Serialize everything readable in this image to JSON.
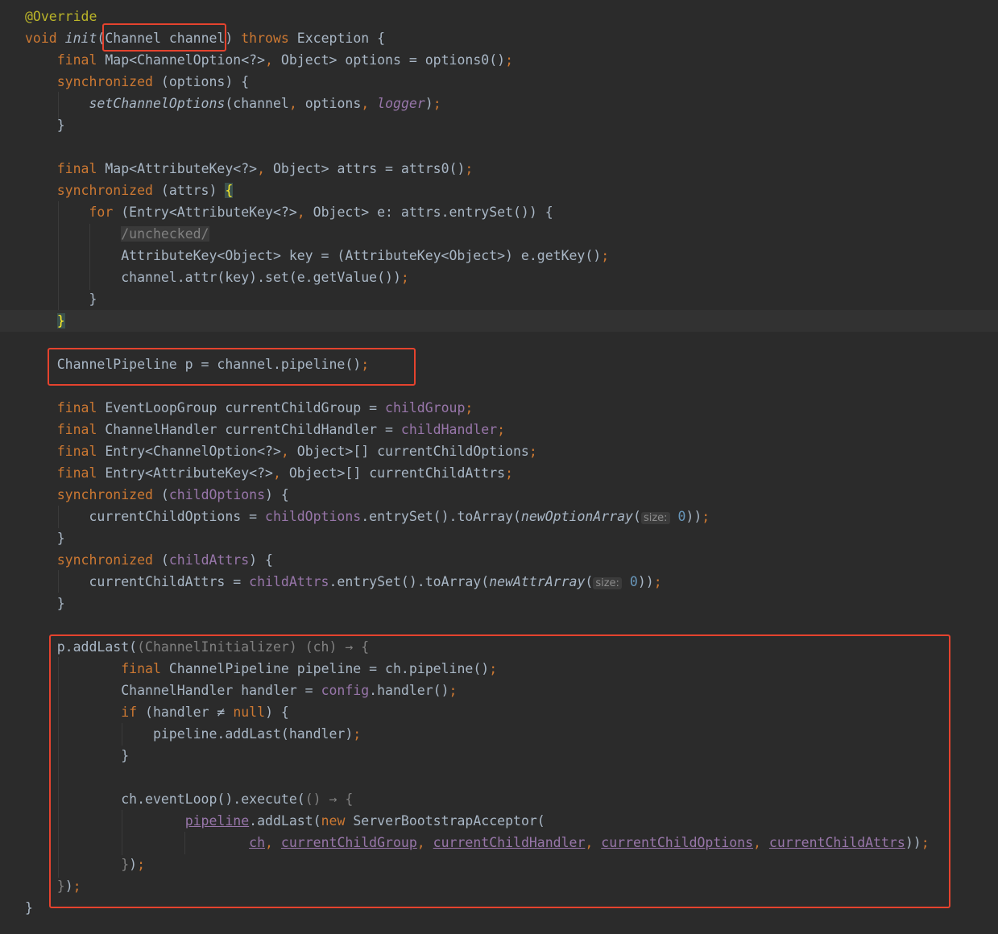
{
  "code": {
    "lines": [
      [
        {
          "t": "@Override",
          "c": "ann"
        }
      ],
      [
        {
          "t": "void ",
          "c": "kw"
        },
        {
          "t": "init",
          "c": "it"
        },
        {
          "t": "("
        },
        {
          "t": "Channel channel"
        },
        {
          "t": ") "
        },
        {
          "t": "throws ",
          "c": "kw"
        },
        {
          "t": "Exception {"
        }
      ],
      [
        {
          "t": "    "
        },
        {
          "t": "final ",
          "c": "kw"
        },
        {
          "t": "Map<ChannelOption<?>"
        },
        {
          "t": ", ",
          "c": "kw"
        },
        {
          "t": "Object> options = options0()"
        },
        {
          "t": ";",
          "c": "kw"
        }
      ],
      [
        {
          "t": "    "
        },
        {
          "t": "synchronized ",
          "c": "kw"
        },
        {
          "t": "(options) {"
        }
      ],
      [
        {
          "t": "        "
        },
        {
          "t": "setChannelOptions",
          "c": "it"
        },
        {
          "t": "(channel"
        },
        {
          "t": ", ",
          "c": "kw"
        },
        {
          "t": "options"
        },
        {
          "t": ", ",
          "c": "kw"
        },
        {
          "t": "logger",
          "c": "field it"
        },
        {
          "t": ")"
        },
        {
          "t": ";",
          "c": "kw"
        }
      ],
      [
        {
          "t": "    }"
        }
      ],
      [],
      [
        {
          "t": "    "
        },
        {
          "t": "final ",
          "c": "kw"
        },
        {
          "t": "Map<AttributeKey<?>"
        },
        {
          "t": ", ",
          "c": "kw"
        },
        {
          "t": "Object> attrs = attrs0()"
        },
        {
          "t": ";",
          "c": "kw"
        }
      ],
      [
        {
          "t": "    "
        },
        {
          "t": "synchronized ",
          "c": "kw"
        },
        {
          "t": "(attrs) "
        },
        {
          "t": "{",
          "c": "brace-match"
        }
      ],
      [
        {
          "t": "        "
        },
        {
          "t": "for ",
          "c": "kw"
        },
        {
          "t": "(Entry<AttributeKey<?>"
        },
        {
          "t": ", ",
          "c": "kw"
        },
        {
          "t": "Object> e: attrs.entrySet()) {"
        }
      ],
      [
        {
          "t": "            "
        },
        {
          "t": "/unchecked/",
          "c": "cmt"
        }
      ],
      [
        {
          "t": "            AttributeKey<Object> key = (AttributeKey<Object>) e.getKey()"
        },
        {
          "t": ";",
          "c": "kw"
        }
      ],
      [
        {
          "t": "            channel.attr(key).set(e.getValue())"
        },
        {
          "t": ";",
          "c": "kw"
        }
      ],
      [
        {
          "t": "        }"
        }
      ],
      [
        {
          "t": "    "
        },
        {
          "t": "}",
          "c": "brace-match"
        }
      ],
      [],
      [
        {
          "t": "    ChannelPipeline p = channel.pipeline()"
        },
        {
          "t": ";",
          "c": "kw"
        }
      ],
      [],
      [
        {
          "t": "    "
        },
        {
          "t": "final ",
          "c": "kw"
        },
        {
          "t": "EventLoopGroup currentChildGroup = "
        },
        {
          "t": "childGroup",
          "c": "field"
        },
        {
          "t": ";",
          "c": "kw"
        }
      ],
      [
        {
          "t": "    "
        },
        {
          "t": "final ",
          "c": "kw"
        },
        {
          "t": "ChannelHandler currentChildHandler = "
        },
        {
          "t": "childHandler",
          "c": "field"
        },
        {
          "t": ";",
          "c": "kw"
        }
      ],
      [
        {
          "t": "    "
        },
        {
          "t": "final ",
          "c": "kw"
        },
        {
          "t": "Entry<ChannelOption<?>"
        },
        {
          "t": ", ",
          "c": "kw"
        },
        {
          "t": "Object>[] currentChildOptions"
        },
        {
          "t": ";",
          "c": "kw"
        }
      ],
      [
        {
          "t": "    "
        },
        {
          "t": "final ",
          "c": "kw"
        },
        {
          "t": "Entry<AttributeKey<?>"
        },
        {
          "t": ", ",
          "c": "kw"
        },
        {
          "t": "Object>[] currentChildAttrs"
        },
        {
          "t": ";",
          "c": "kw"
        }
      ],
      [
        {
          "t": "    "
        },
        {
          "t": "synchronized ",
          "c": "kw"
        },
        {
          "t": "("
        },
        {
          "t": "childOptions",
          "c": "field"
        },
        {
          "t": ") {"
        }
      ],
      [
        {
          "t": "        currentChildOptions = "
        },
        {
          "t": "childOptions",
          "c": "field"
        },
        {
          "t": ".entrySet().toArray("
        },
        {
          "t": "newOptionArray",
          "c": "it"
        },
        {
          "t": "("
        },
        {
          "t": "size:",
          "c": "hint"
        },
        {
          "t": " "
        },
        {
          "t": "0",
          "c": "num"
        },
        {
          "t": "))"
        },
        {
          "t": ";",
          "c": "kw"
        }
      ],
      [
        {
          "t": "    }"
        }
      ],
      [
        {
          "t": "    "
        },
        {
          "t": "synchronized ",
          "c": "kw"
        },
        {
          "t": "("
        },
        {
          "t": "childAttrs",
          "c": "field"
        },
        {
          "t": ") {"
        }
      ],
      [
        {
          "t": "        currentChildAttrs = "
        },
        {
          "t": "childAttrs",
          "c": "field"
        },
        {
          "t": ".entrySet().toArray("
        },
        {
          "t": "newAttrArray",
          "c": "it"
        },
        {
          "t": "("
        },
        {
          "t": "size:",
          "c": "hint"
        },
        {
          "t": " "
        },
        {
          "t": "0",
          "c": "num"
        },
        {
          "t": "))"
        },
        {
          "t": ";",
          "c": "kw"
        }
      ],
      [
        {
          "t": "    }"
        }
      ],
      [],
      [
        {
          "t": "    p.addLast("
        },
        {
          "t": "(ChannelInitializer) (ch) → {",
          "c": "gray"
        }
      ],
      [
        {
          "t": "            "
        },
        {
          "t": "final ",
          "c": "kw"
        },
        {
          "t": "ChannelPipeline pipeline = ch.pipeline()"
        },
        {
          "t": ";",
          "c": "kw"
        }
      ],
      [
        {
          "t": "            ChannelHandler handler = "
        },
        {
          "t": "config",
          "c": "field"
        },
        {
          "t": ".handler()"
        },
        {
          "t": ";",
          "c": "kw"
        }
      ],
      [
        {
          "t": "            "
        },
        {
          "t": "if ",
          "c": "kw"
        },
        {
          "t": "(handler ≠ "
        },
        {
          "t": "null",
          "c": "kw"
        },
        {
          "t": ") {"
        }
      ],
      [
        {
          "t": "                pipeline.addLast(handler)"
        },
        {
          "t": ";",
          "c": "kw"
        }
      ],
      [
        {
          "t": "            }"
        }
      ],
      [],
      [
        {
          "t": "            ch.eventLoop().execute("
        },
        {
          "t": "() → {",
          "c": "gray"
        }
      ],
      [
        {
          "t": "                    "
        },
        {
          "t": "pipeline",
          "c": "field ul"
        },
        {
          "t": ".addLast("
        },
        {
          "t": "new ",
          "c": "kw"
        },
        {
          "t": "ServerBootstrapAcceptor("
        }
      ],
      [
        {
          "t": "                            "
        },
        {
          "t": "ch",
          "c": "field ul"
        },
        {
          "t": ", ",
          "c": "kw"
        },
        {
          "t": "currentChildGroup",
          "c": "field ul"
        },
        {
          "t": ", ",
          "c": "kw"
        },
        {
          "t": "currentChildHandler",
          "c": "field ul"
        },
        {
          "t": ", ",
          "c": "kw"
        },
        {
          "t": "currentChildOptions",
          "c": "field ul"
        },
        {
          "t": ", ",
          "c": "kw"
        },
        {
          "t": "currentChildAttrs",
          "c": "field ul"
        },
        {
          "t": "))"
        },
        {
          "t": ";",
          "c": "kw"
        }
      ],
      [
        {
          "t": "            "
        },
        {
          "t": "}",
          "c": "gray"
        },
        {
          "t": ")"
        },
        {
          "t": ";",
          "c": "kw"
        }
      ],
      [
        {
          "t": "    "
        },
        {
          "t": "}",
          "c": "gray"
        },
        {
          "t": ")"
        },
        {
          "t": ";",
          "c": "kw"
        }
      ],
      [
        {
          "t": "}"
        }
      ]
    ]
  },
  "colors": {
    "background": "#2b2b2b",
    "keyword": "#cc7832",
    "annotation": "#bbb529",
    "field": "#9876aa",
    "default_text": "#a9b7c6",
    "number": "#6897bb",
    "highlight_box": "#e5432e"
  }
}
